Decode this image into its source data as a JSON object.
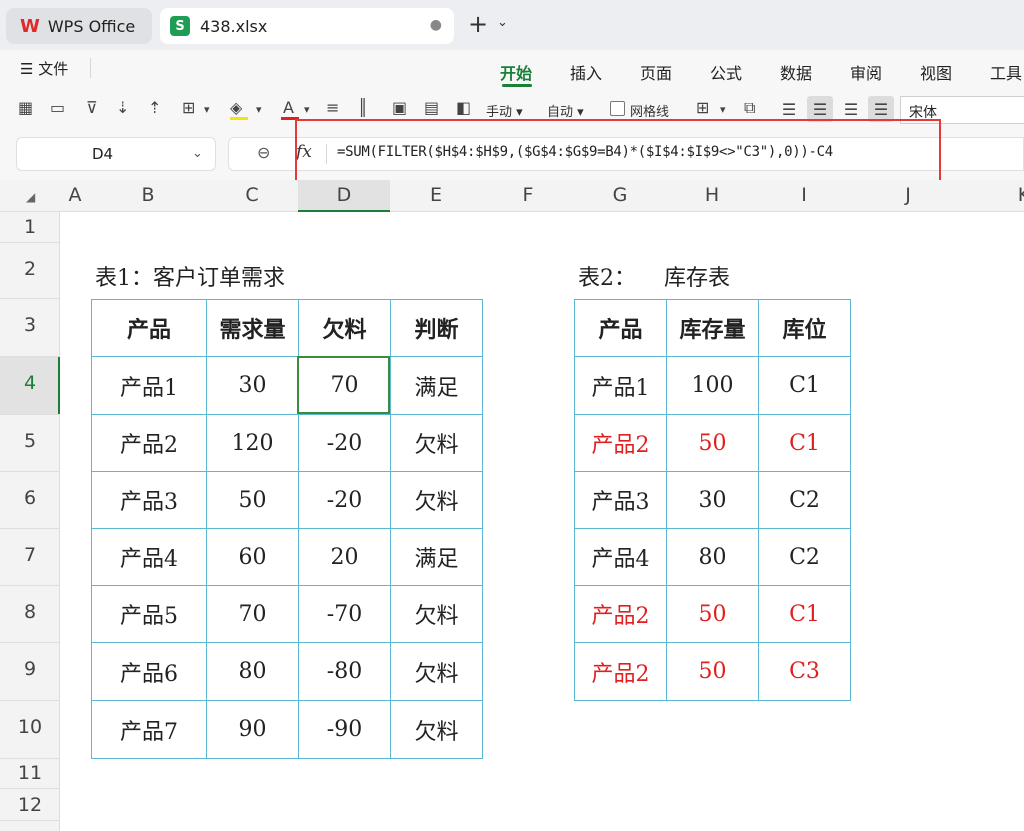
{
  "tabs": {
    "app": "WPS Office",
    "file": "438.xlsx",
    "dot": "●",
    "plus": "+",
    "arrow": "⌄"
  },
  "menu": {
    "label": "文件",
    "icon": "☰"
  },
  "ribbon_tabs": [
    "开始",
    "插入",
    "页面",
    "公式",
    "数据",
    "审阅",
    "视图",
    "工具"
  ],
  "toolbar": {
    "fill_mode": "手动",
    "auto": "自动",
    "gridlines": "网格线",
    "font": "宋体"
  },
  "formula_bar": {
    "cell": "D4",
    "formula": "=SUM(FILTER($H$4:$H$9,($G$4:$G$9=B4)*($I$4:$I$9<>\"C3\"),0))-C4"
  },
  "columns": [
    "A",
    "B",
    "C",
    "D",
    "E",
    "F",
    "G",
    "H",
    "I",
    "J",
    "K"
  ],
  "rows": [
    "1",
    "2",
    "3",
    "4",
    "5",
    "6",
    "7",
    "8",
    "9",
    "10",
    "11",
    "12"
  ],
  "table1": {
    "title": "表1：客户订单需求",
    "headers": [
      "产品",
      "需求量",
      "欠料",
      "判断"
    ],
    "rows": [
      [
        "产品1",
        "30",
        "70",
        "满足"
      ],
      [
        "产品2",
        "120",
        "-20",
        "欠料"
      ],
      [
        "产品3",
        "50",
        "-20",
        "欠料"
      ],
      [
        "产品4",
        "60",
        "20",
        "满足"
      ],
      [
        "产品5",
        "70",
        "-70",
        "欠料"
      ],
      [
        "产品6",
        "80",
        "-80",
        "欠料"
      ],
      [
        "产品7",
        "90",
        "-90",
        "欠料"
      ]
    ]
  },
  "table2": {
    "title": "表2：    库存表",
    "headers": [
      "产品",
      "库存量",
      "库位"
    ],
    "rows": [
      [
        "产品1",
        "100",
        "C1"
      ],
      [
        "产品2",
        "50",
        "C1"
      ],
      [
        "产品3",
        "30",
        "C2"
      ],
      [
        "产品4",
        "80",
        "C2"
      ],
      [
        "产品2",
        "50",
        "C1"
      ],
      [
        "产品2",
        "50",
        "C3"
      ]
    ],
    "highlight_rows": [
      1,
      4,
      5
    ],
    "highlight_color": "#e02020"
  },
  "colors": {
    "accent": "#1a7f37",
    "annotation": "#e53935",
    "grid_border": "#5bb8d4"
  }
}
